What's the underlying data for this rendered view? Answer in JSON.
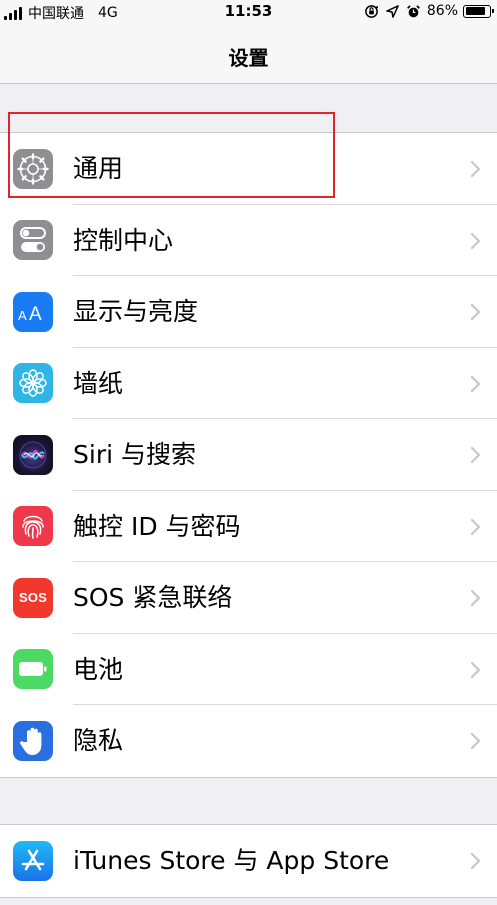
{
  "status_bar": {
    "carrier": "中国联通",
    "network": "4G",
    "time": "11:53",
    "battery_percent": "86%",
    "battery_level": 0.86,
    "icons": [
      "orientation-lock-icon",
      "location-icon",
      "alarm-icon"
    ]
  },
  "nav": {
    "title": "设置"
  },
  "groups": [
    {
      "items": [
        {
          "id": "general",
          "label": "通用",
          "icon": "gear-icon",
          "color": "#8e8e93"
        },
        {
          "id": "control-center",
          "label": "控制中心",
          "icon": "toggles-icon",
          "color": "#8e8e93"
        },
        {
          "id": "display",
          "label": "显示与亮度",
          "icon": "text-size-icon",
          "color": "#1a7cf2"
        },
        {
          "id": "wallpaper",
          "label": "墙纸",
          "icon": "flower-icon",
          "color": "#2fb5e6"
        },
        {
          "id": "siri",
          "label": "Siri 与搜索",
          "icon": "siri-icon",
          "color": "#1a1430"
        },
        {
          "id": "touch-id",
          "label": "触控 ID 与密码",
          "icon": "fingerprint-icon",
          "color": "#f0384b"
        },
        {
          "id": "sos",
          "label": "SOS 紧急联络",
          "icon": "sos-icon",
          "icon_text": "SOS",
          "color": "#f0392c"
        },
        {
          "id": "battery",
          "label": "电池",
          "icon": "battery-icon",
          "color": "#4cd964"
        },
        {
          "id": "privacy",
          "label": "隐私",
          "icon": "hand-icon",
          "color": "#2a6fe0"
        }
      ]
    },
    {
      "items": [
        {
          "id": "itunes-appstore",
          "label": "iTunes Store 与 App Store",
          "icon": "app-store-icon",
          "color": "#1a73e8"
        }
      ]
    }
  ],
  "highlight": {
    "target": "general",
    "color": "#e0242b"
  }
}
